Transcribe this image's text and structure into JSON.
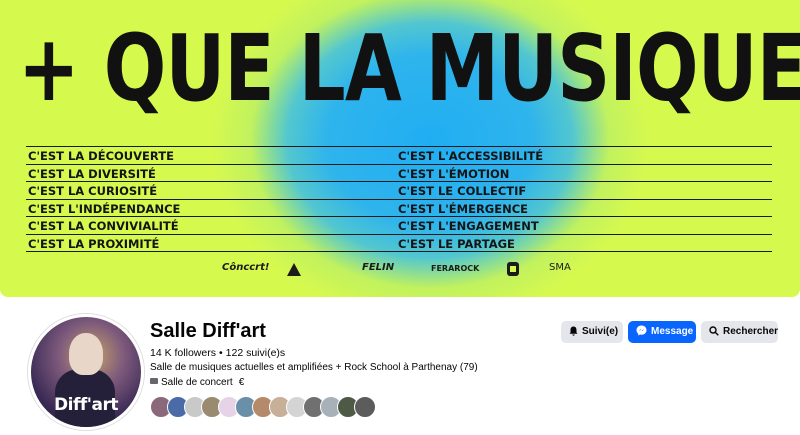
{
  "cover": {
    "title": "+ QUE LA MUSIQUE",
    "slogans_left": [
      "C'EST LA DÉCOUVERTE",
      "C'EST LA DIVERSITÉ",
      "C'EST LA CURIOSITÉ",
      "C'EST L'INDÉPENDANCE",
      "C'EST LA CONVIVIALITÉ",
      "C'EST LA PROXIMITÉ"
    ],
    "slogans_right": [
      "C'EST L'ACCESSIBILITÉ",
      "C'EST L'ÉMOTION",
      "C'EST LE COLLECTIF",
      "C'EST L'ÉMERGENCE",
      "C'EST L'ENGAGEMENT",
      "C'EST LE PARTAGE"
    ],
    "partners": {
      "concert": "Cônccrt!",
      "felin": "FELIN",
      "ferarock": "FERAROCK",
      "smа": "SMA"
    },
    "colors": {
      "background": "#d6f94e",
      "blob": "#20aef3"
    }
  },
  "profile": {
    "avatar_text": "Diff'art",
    "name": "Salle Diff'art",
    "followers": "14 K followers",
    "following": "122 suivi(e)s",
    "separator": "•",
    "bio": "Salle de musiques actuelles et amplifiées + Rock School à Parthenay (79)",
    "category": "Salle de concert",
    "price": "€"
  },
  "actions": {
    "follow": "Suivi(e)",
    "message": "Message",
    "search": "Rechercher"
  },
  "icons": {
    "follow": "bell-icon",
    "message": "messenger-icon",
    "search": "search-icon",
    "category": "briefcase-icon"
  }
}
